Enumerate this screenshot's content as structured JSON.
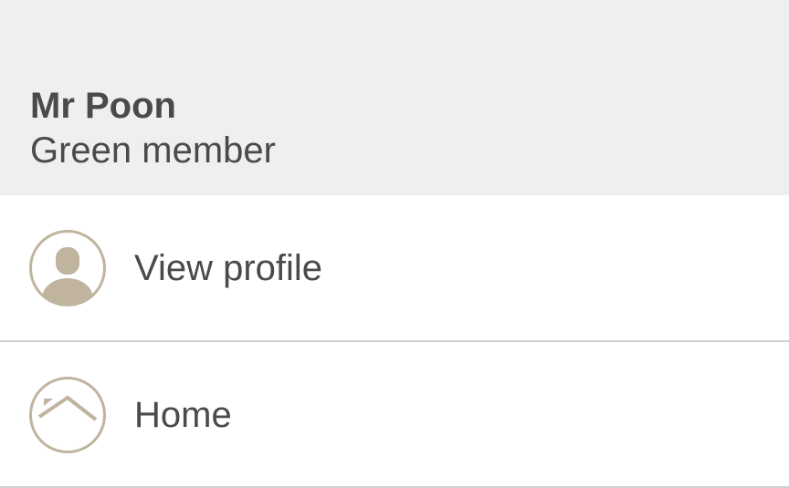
{
  "profile": {
    "name": "Mr Poon",
    "tier": "Green member"
  },
  "menu": {
    "items": [
      {
        "label": "View profile",
        "icon": "person-icon"
      },
      {
        "label": "Home",
        "icon": "home-icon"
      }
    ]
  },
  "colors": {
    "header_background": "#efefef",
    "text": "#4a4a4a",
    "icon_accent": "#c0b49f",
    "divider": "#d0d0d0"
  }
}
